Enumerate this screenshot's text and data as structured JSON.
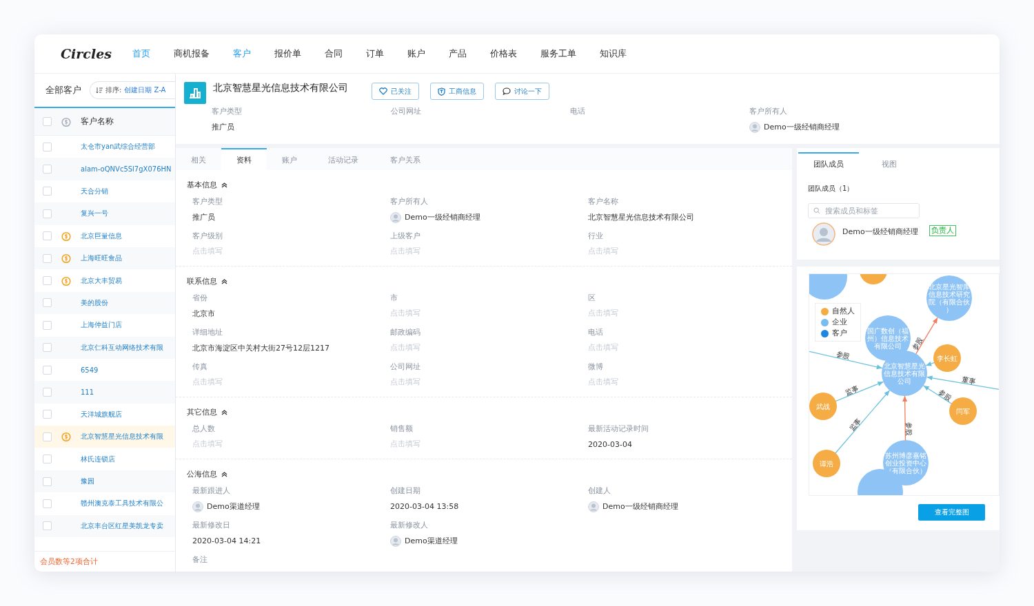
{
  "logo": "Circles",
  "nav": [
    {
      "label": "首页",
      "selected": true
    },
    {
      "label": "商机报备",
      "selected": false
    },
    {
      "label": "客户",
      "selected": true
    },
    {
      "label": "报价单",
      "selected": false
    },
    {
      "label": "合同",
      "selected": false
    },
    {
      "label": "订单",
      "selected": false
    },
    {
      "label": "账户",
      "selected": false
    },
    {
      "label": "产品",
      "selected": false
    },
    {
      "label": "价格表",
      "selected": false
    },
    {
      "label": "服务工单",
      "selected": false
    },
    {
      "label": "知识库",
      "selected": false
    }
  ],
  "list": {
    "title": "全部客户",
    "sort_label": "排序:",
    "sort_value": "创建日期 Z-A",
    "column": "客户名称",
    "all_checked": false,
    "footer": "会员数等2项合计",
    "rows": [
      {
        "name": "太仓市yan武综合经营部",
        "paid": false,
        "selected": false,
        "checked": false
      },
      {
        "name": "alam-oQNVc5Sl7gX076HN",
        "paid": false,
        "selected": false,
        "checked": false
      },
      {
        "name": "天合分销",
        "paid": false,
        "selected": false,
        "checked": false
      },
      {
        "name": "复兴一号",
        "paid": false,
        "selected": false,
        "checked": false
      },
      {
        "name": "北京巨量信息",
        "paid": true,
        "selected": false,
        "checked": false
      },
      {
        "name": "上海旺旺食品",
        "paid": true,
        "selected": false,
        "checked": false
      },
      {
        "name": "北京大丰贸易",
        "paid": true,
        "selected": false,
        "checked": false
      },
      {
        "name": "美的股份",
        "paid": false,
        "selected": false,
        "checked": false
      },
      {
        "name": "上海仲益门店",
        "paid": false,
        "selected": false,
        "checked": false
      },
      {
        "name": "北京仁科互动网络技术有限",
        "paid": false,
        "selected": false,
        "checked": false
      },
      {
        "name": "6549",
        "paid": false,
        "selected": false,
        "checked": false
      },
      {
        "name": "111",
        "paid": false,
        "selected": false,
        "checked": false
      },
      {
        "name": "天洋城旗舰店",
        "paid": false,
        "selected": false,
        "checked": false
      },
      {
        "name": "北京智慧星光信息技术有限",
        "paid": true,
        "selected": true,
        "checked": false
      },
      {
        "name": "林氏连锁店",
        "paid": false,
        "selected": false,
        "checked": false
      },
      {
        "name": "豫园",
        "paid": false,
        "selected": false,
        "checked": false
      },
      {
        "name": "赣州澳克泰工具技术有限公",
        "paid": false,
        "selected": false,
        "checked": false
      },
      {
        "name": "北京丰台区红星美凯龙专卖",
        "paid": false,
        "selected": false,
        "checked": false
      }
    ]
  },
  "header": {
    "title": "北京智慧星光信息技术有限公司",
    "buttons": [
      {
        "label": "已关注",
        "kind": "heart"
      },
      {
        "label": "工商信息",
        "kind": "shield"
      },
      {
        "label": "讨论一下",
        "kind": "chat"
      }
    ],
    "summary": [
      {
        "label": "客户类型",
        "value": "推广员",
        "kind": "text"
      },
      {
        "label": "公司网址",
        "kind": "none"
      },
      {
        "label": "电话",
        "kind": "none"
      },
      {
        "label": "客户所有人",
        "value": "Demo一级经销商经理",
        "kind": "person"
      }
    ]
  },
  "tabs": [
    {
      "label": "相关",
      "selected": false
    },
    {
      "label": "资料",
      "selected": true
    },
    {
      "label": "账户",
      "selected": false
    },
    {
      "label": "活动记录",
      "selected": false
    },
    {
      "label": "客户关系",
      "selected": false
    }
  ],
  "sections": [
    {
      "title": "基本信息",
      "expanded": true,
      "fields": [
        {
          "label": "客户类型",
          "value": "推广员",
          "kind": "text"
        },
        {
          "label": "客户所有人",
          "value": "Demo一级经销商经理",
          "kind": "person"
        },
        {
          "label": "客户名称",
          "value": "北京智慧星光信息技术有限公司",
          "kind": "text"
        },
        {
          "label": "客户级别",
          "placeholder": "点击填写",
          "kind": "empty"
        },
        {
          "label": "上级客户",
          "placeholder": "点击填写",
          "kind": "empty"
        },
        {
          "label": "行业",
          "placeholder": "点击填写",
          "kind": "empty"
        }
      ]
    },
    {
      "title": "联系信息",
      "expanded": true,
      "fields": [
        {
          "label": "省份",
          "value": "北京市",
          "kind": "text"
        },
        {
          "label": "市",
          "placeholder": "点击填写",
          "kind": "empty"
        },
        {
          "label": "区",
          "placeholder": "点击填写",
          "kind": "empty"
        },
        {
          "label": "详细地址",
          "value": "北京市海淀区中关村大街27号12层1217",
          "kind": "text"
        },
        {
          "label": "邮政编码",
          "placeholder": "点击填写",
          "kind": "empty"
        },
        {
          "label": "电话",
          "placeholder": "点击填写",
          "kind": "empty"
        },
        {
          "label": "传真",
          "placeholder": "点击填写",
          "kind": "empty"
        },
        {
          "label": "公司网址",
          "placeholder": "点击填写",
          "kind": "empty"
        },
        {
          "label": "微博",
          "placeholder": "点击填写",
          "kind": "empty"
        }
      ]
    },
    {
      "title": "其它信息",
      "expanded": true,
      "fields": [
        {
          "label": "总人数",
          "placeholder": "点击填写",
          "kind": "empty"
        },
        {
          "label": "销售额",
          "placeholder": "点击填写",
          "kind": "empty"
        },
        {
          "label": "最新活动记录时间",
          "value": "2020-03-04",
          "kind": "text"
        }
      ]
    },
    {
      "title": "公海信息",
      "expanded": true,
      "fields": [
        {
          "label": "最新跟进人",
          "value": "Demo渠道经理",
          "kind": "person"
        },
        {
          "label": "创建日期",
          "value": "2020-03-04 13:58",
          "kind": "text"
        },
        {
          "label": "创建人",
          "value": "Demo一级经销商经理",
          "kind": "person"
        },
        {
          "label": "最新修改日",
          "value": "2020-03-04 14:21",
          "kind": "text"
        },
        {
          "label": "最新修改人",
          "value": "Demo渠道经理",
          "kind": "person"
        },
        {
          "kind": "none"
        },
        {
          "label": "备注",
          "kind": "none"
        }
      ]
    }
  ],
  "side": {
    "tabs": [
      {
        "label": "团队成员",
        "selected": true
      },
      {
        "label": "视图",
        "selected": false
      }
    ],
    "count": "团队成员（1）",
    "search": {
      "placeholder": "搜索成员和标签"
    },
    "members": [
      {
        "name": "Demo一级经销商经理",
        "tag": "负责人"
      }
    ],
    "legend": [
      {
        "label": "自然人",
        "color": "#f5ac45"
      },
      {
        "label": "企业",
        "color": "#79bdf0"
      },
      {
        "label": "客户",
        "color": "#1f86e0"
      }
    ],
    "graph_nodes": [
      {
        "label": "国广数创（福州）信息技术有限公司",
        "kind": "company"
      },
      {
        "label": "北京星光智库信息技术研究院（有限合伙）",
        "kind": "company"
      },
      {
        "kind": "company"
      },
      {
        "label": "李长虹",
        "kind": "person"
      },
      {
        "label": "闫军",
        "kind": "person"
      },
      {
        "label": "武战",
        "kind": "person"
      },
      {
        "label": "谭浩",
        "kind": "person"
      },
      {
        "label": "北京智慧星光信息技术有限公司",
        "kind": "company"
      },
      {
        "label": "苏州博彦嘉铭创业投资中心（有限合伙）",
        "kind": "company"
      },
      {
        "kind": "company"
      },
      {
        "kind": "person"
      }
    ],
    "graph_edges": [
      {
        "kind": "role"
      },
      {
        "label": "参股",
        "kind": "stake"
      },
      {
        "kind": "role"
      },
      {
        "label": "参股",
        "kind": "role"
      },
      {
        "label": "董事",
        "kind": "role"
      },
      {
        "label": "参股",
        "kind": "role"
      },
      {
        "label": "监事",
        "kind": "role"
      },
      {
        "label": "监事",
        "kind": "role"
      },
      {
        "label": "参股",
        "kind": "stake"
      }
    ],
    "graph_button": "查看完整图"
  }
}
